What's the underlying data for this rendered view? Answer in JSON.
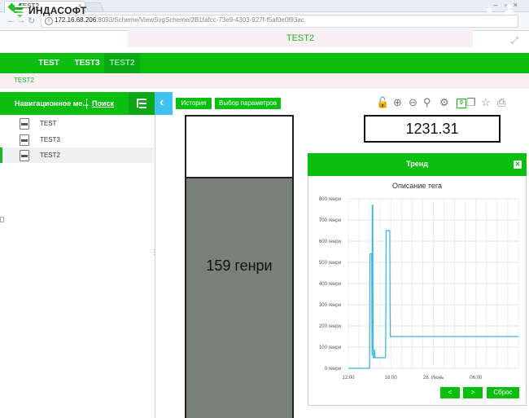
{
  "browser": {
    "tab_title": "TEST2",
    "url_host": "172.16.68.206",
    "url_rest": ":8093/Scheme/ViewSvgScheme/2B1fafcc-73e9-4303-927f-f5af0e0f93ac"
  },
  "header": {
    "logo_text": "ИНДАСОФТ",
    "page_title": "TEST2"
  },
  "nav": {
    "tabs": [
      {
        "label": "TEST"
      },
      {
        "label": "TEST3"
      },
      {
        "label": "TEST2"
      }
    ]
  },
  "breadcrumb": "TEST2",
  "sidebar": {
    "title": "Навигационное ме...",
    "search_label": "Поиск",
    "items": [
      {
        "label": "TEST"
      },
      {
        "label": "TEST3"
      },
      {
        "label": "TEST2"
      }
    ]
  },
  "toolbar": {
    "history_label": "История",
    "params_label": "Выбор параметров",
    "counter": "0",
    "icons": [
      "lock-icon",
      "zoom-in-icon",
      "zoom-out-icon",
      "search-icon",
      "gears-icon",
      "copy-icon",
      "star-icon",
      "print-icon"
    ]
  },
  "gauge": {
    "level": 0.79,
    "label": "159 генри"
  },
  "value_display": "1231.31",
  "trend": {
    "title": "Тренд",
    "subtitle": "Описание тега",
    "prev_label": "<",
    "next_label": ">",
    "reset_label": "Сброс"
  },
  "colors": {
    "accent_green": "#0bbf10",
    "trend_line": "#34b4e8",
    "gauge_fill": "#788079"
  },
  "chart_data": {
    "type": "line",
    "ylim": [
      0,
      800
    ],
    "yticks": [
      0,
      100,
      200,
      300,
      400,
      500,
      600,
      700,
      800
    ],
    "yunit": "генри",
    "ytick_labels": [
      "0 генри",
      "100 генри",
      "200 генри",
      "300 генри",
      "400 генри",
      "500 генри",
      "600 генри",
      "700 генри",
      "800 генри"
    ],
    "xlim": [
      0,
      320
    ],
    "xticks": [
      {
        "x": 0,
        "label": "12:00"
      },
      {
        "x": 80,
        "label": "18:00"
      },
      {
        "x": 160,
        "label": "28. Июнь"
      },
      {
        "x": 240,
        "label": "06:00"
      }
    ],
    "series": [
      {
        "x": [
          0,
          40,
          40.5,
          41,
          44,
          44.5,
          45,
          46,
          46.5,
          47,
          49,
          49.5,
          50,
          70,
          70.5,
          71,
          78,
          78.5,
          79,
          320
        ],
        "y": [
          0,
          0,
          520,
          540,
          540,
          60,
          770,
          770,
          100,
          50,
          50,
          90,
          50,
          50,
          180,
          650,
          650,
          280,
          150,
          150
        ]
      }
    ]
  }
}
